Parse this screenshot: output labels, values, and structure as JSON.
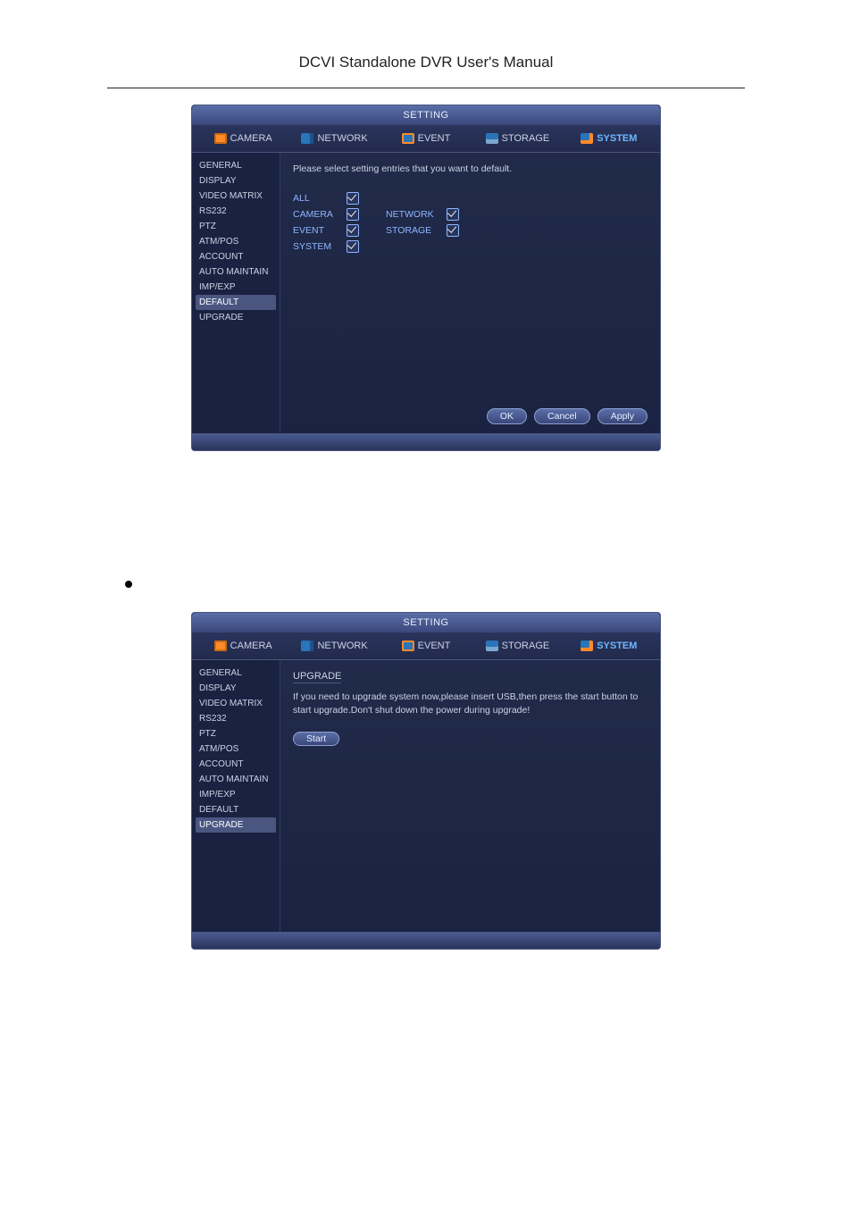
{
  "doc": {
    "header_title": "DCVI Standalone DVR User's Manual"
  },
  "fig1": {
    "window_title": "SETTING",
    "tabs": {
      "camera": "CAMERA",
      "network": "NETWORK",
      "event": "EVENT",
      "storage": "STORAGE",
      "system": "SYSTEM"
    },
    "sidebar": [
      "GENERAL",
      "DISPLAY",
      "VIDEO MATRIX",
      "RS232",
      "PTZ",
      "ATM/POS",
      "ACCOUNT",
      "AUTO MAINTAIN",
      "IMP/EXP",
      "DEFAULT",
      "UPGRADE"
    ],
    "sidebar_selected": "DEFAULT",
    "prompt": "Please select setting entries that you want to default.",
    "checks": {
      "all": "ALL",
      "camera": "CAMERA",
      "event": "EVENT",
      "system": "SYSTEM",
      "network": "NETWORK",
      "storage": "STORAGE"
    },
    "buttons": {
      "ok": "OK",
      "cancel": "Cancel",
      "apply": "Apply"
    }
  },
  "fig2": {
    "window_title": "SETTING",
    "tabs": {
      "camera": "CAMERA",
      "network": "NETWORK",
      "event": "EVENT",
      "storage": "STORAGE",
      "system": "SYSTEM"
    },
    "sidebar": [
      "GENERAL",
      "DISPLAY",
      "VIDEO MATRIX",
      "RS232",
      "PTZ",
      "ATM/POS",
      "ACCOUNT",
      "AUTO MAINTAIN",
      "IMP/EXP",
      "DEFAULT",
      "UPGRADE"
    ],
    "sidebar_selected": "UPGRADE",
    "box_title": "UPGRADE",
    "upgrade_text": "If you need to upgrade system now,please insert USB,then press the start button to start upgrade.Don't shut down the power during upgrade!",
    "start": "Start"
  }
}
